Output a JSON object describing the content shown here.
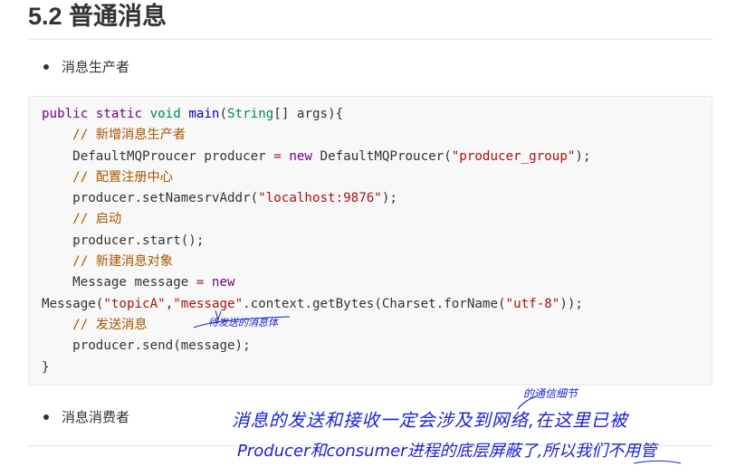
{
  "heading": "5.2 普通消息",
  "bullets": {
    "producer": "消息生产者",
    "consumer": "消息消费者"
  },
  "code": {
    "l1": {
      "k1": "public",
      "k2": "static",
      "t1": "void",
      "f1": "main",
      "p1": "(",
      "t2": "String",
      "p2": "[] args){"
    },
    "l2": "// 新增消息生产者",
    "l3": {
      "a": "DefaultMQProucer producer ",
      "op": "=",
      "kw": " new",
      "b": " DefaultMQProucer(",
      "s": "\"producer_group\"",
      "c": ");"
    },
    "l4": "// 配置注册中心",
    "l5": {
      "a": "producer.setNamesrvAddr(",
      "s": "\"localhost:9876\"",
      "c": ");"
    },
    "l6": "// 启动",
    "l7": "producer.start();",
    "l8": "// 新建消息对象",
    "l9": {
      "a": "Message message ",
      "op": "=",
      "kw": " new"
    },
    "l10": {
      "a": "Message(",
      "s1": "\"topicA\"",
      "b": ",",
      "s2": "\"message\"",
      "c": ".context.getBytes(Charset.forName(",
      "s3": "\"utf-8\"",
      "d": "));"
    },
    "l11": "// 发送消息",
    "l12": "producer.send(message);",
    "l13": "}"
  },
  "annotations": {
    "note_small": "待发送的消息体",
    "note_line1": "消息的发送和接收一定会涉及到网络,在这里已被",
    "note_insert": "的通信细节",
    "note_line2": "Producer和consumer进程的底层屏蔽了,所以我们不用管"
  },
  "colors": {
    "keyword": "#770088",
    "type": "#008855",
    "function": "#0000cc",
    "string": "#aa1111",
    "comment": "#aa5500",
    "handwriting": "#1a22d8"
  }
}
